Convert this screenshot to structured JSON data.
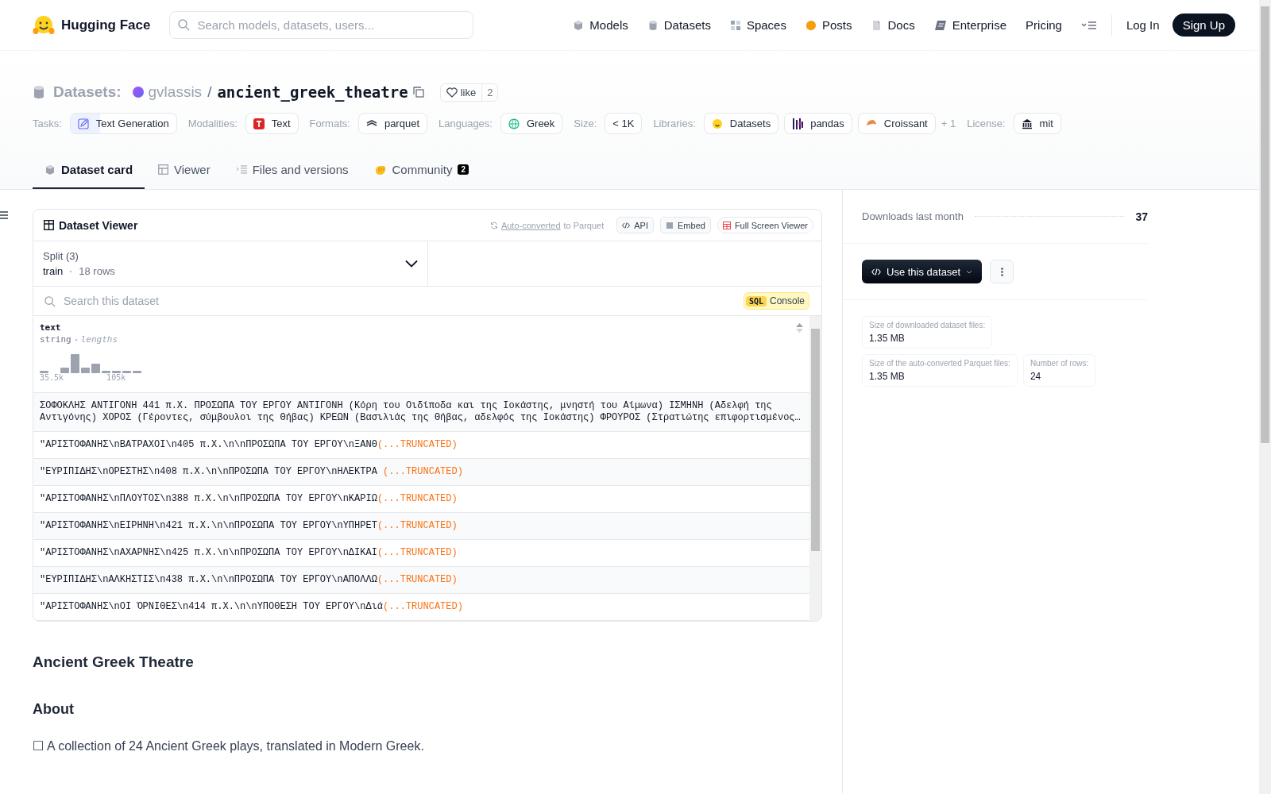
{
  "nav": {
    "brand": "Hugging Face",
    "search": {
      "placeholder": "Search models, datasets, users..."
    },
    "links": [
      {
        "label": "Models"
      },
      {
        "label": "Datasets"
      },
      {
        "label": "Spaces"
      },
      {
        "label": "Posts"
      },
      {
        "label": "Docs"
      },
      {
        "label": "Enterprise"
      },
      {
        "label": "Pricing"
      }
    ],
    "login": "Log In",
    "signup": "Sign Up"
  },
  "header": {
    "category": "Datasets:",
    "owner": "gvlassis",
    "separator": "/",
    "name": "ancient_greek_theatre",
    "like": "like",
    "likes": "2",
    "tag_groups": [
      {
        "label": "Tasks:",
        "items": [
          "Text Generation"
        ]
      },
      {
        "label": "Modalities:",
        "items": [
          "Text"
        ]
      },
      {
        "label": "Formats:",
        "items": [
          "parquet"
        ]
      },
      {
        "label": "Languages:",
        "items": [
          "Greek"
        ]
      },
      {
        "label": "Size:",
        "items": [
          "< 1K"
        ]
      },
      {
        "label": "Libraries:",
        "items": [
          "Datasets",
          "pandas",
          "Croissant"
        ],
        "more": "+ 1"
      },
      {
        "label": "License:",
        "items": [
          "mit"
        ]
      }
    ],
    "tabs": [
      {
        "label": "Dataset card",
        "selected": true
      },
      {
        "label": "Viewer",
        "selected": false
      },
      {
        "label": "Files and versions",
        "selected": false
      },
      {
        "label": "Community",
        "selected": false,
        "badge": "2"
      }
    ]
  },
  "viewer": {
    "title": "Dataset Viewer",
    "converted_link": "Auto-converted",
    "converted_rest": "to Parquet",
    "buttons": [
      "API",
      "Embed",
      "Full Screen Viewer"
    ],
    "split_label": "Split (3)",
    "split_value": "train",
    "split_rows": "18 rows",
    "search": {
      "placeholder": "Search this dataset"
    },
    "sql_badge": "SQL",
    "sql_label": "Console",
    "column": {
      "name": "text",
      "type": "string",
      "stat": "lengths",
      "axis_min": "35.5k",
      "axis_max": "105k"
    },
    "rows": [
      {
        "text": "ΣΟΦΟΚΛΗΣ ΑΝΤΙΓΟΝΗ 441 π.Χ. ΠΡΟΣΩΠΑ ΤΟΥ ΕΡΓΟΥ ΑΝΤΙΓΟΝΗ (Κόρη του Οιδίποδα και της Ιοκάστης, μνηστή του Αίμωνα) ΙΣΜΗΝΗ (Αδελφή της Αντιγόνης) ΧΟΡΟΣ (Γέροντες, σύμβουλοι της Θήβας) ΚΡΕΩΝ (Βασιλιάς της Θήβας, αδελφός της Ιοκάστης) ΦΡΟΥΡΟΣ (Στρατιώτης επιφορτισμένος…"
      },
      {
        "text": "\"ΑΡΙΣΤΟΦΑΝΗΣ\\nΒΑΤΡΑΧΟΙ\\n405 π.Χ.\\n\\nΠΡΟΣΩΠΑ ΤΟΥ ΕΡΓΟΥ\\nΞΑΝΘ",
        "suffix": "(...TRUNCATED)"
      },
      {
        "text": "\"ΕΥΡΙΠΙΔΗΣ\\nΟΡΕΣΤΗΣ\\n408 π.Χ.\\n\\nΠΡΟΣΩΠΑ ΤΟΥ ΕΡΓΟΥ\\nΗΛΕΚΤΡΑ ",
        "suffix": "(...TRUNCATED)"
      },
      {
        "text": "\"ΑΡΙΣΤΟΦΑΝΗΣ\\nΠΛΟΥΤΟΣ\\n388 π.Χ.\\n\\nΠΡΟΣΩΠΑ ΤΟΥ ΕΡΓΟΥ\\nΚΑΡΙΩ",
        "suffix": "(...TRUNCATED)"
      },
      {
        "text": "\"ΑΡΙΣΤΟΦΑΝΗΣ\\nΕΙΡΗΝΗ\\n421 π.Χ.\\n\\nΠΡΟΣΩΠΑ ΤΟΥ ΕΡΓΟΥ\\nΥΠΗΡΕΤ",
        "suffix": "(...TRUNCATED)"
      },
      {
        "text": "\"ΑΡΙΣΤΟΦΑΝΗΣ\\nΑΧΑΡΝΗΣ\\n425 π.Χ.\\n\\nΠΡΟΣΩΠΑ ΤΟΥ ΕΡΓΟΥ\\nΔΙΚΑΙ",
        "suffix": "(...TRUNCATED)"
      },
      {
        "text": "\"ΕΥΡΙΠΙΔΗΣ\\nΑΛΚΗΣΤΙΣ\\n438 π.Χ.\\n\\nΠΡΟΣΩΠΑ ΤΟΥ ΕΡΓΟΥ\\nΑΠΟΛΛΩ",
        "suffix": "(...TRUNCATED)"
      },
      {
        "text": "\"ΑΡΙΣΤΟΦΑΝΗΣ\\nΟΙ ΌΡΝΙΘΕΣ\\n414 π.Χ.\\n\\nΥΠΟΘΕΣΗ ΤΟΥ ΕΡΓΟΥ\\nΔιά",
        "suffix": "(...TRUNCATED)"
      }
    ]
  },
  "card": {
    "title": "Ancient Greek Theatre",
    "section": "About",
    "paragraph": "☐ A collection of 24 Ancient Greek plays, translated in Modern Greek."
  },
  "sidebar": {
    "downloads_label": "Downloads last month",
    "downloads_value": "37",
    "use_button": "Use this dataset",
    "stats": [
      {
        "label": "Size of downloaded dataset files:",
        "value": "1.35 MB"
      },
      {
        "label": "Size of the auto-converted Parquet files:",
        "value": "1.35 MB"
      },
      {
        "label": "Number of rows:",
        "value": "24"
      }
    ]
  }
}
